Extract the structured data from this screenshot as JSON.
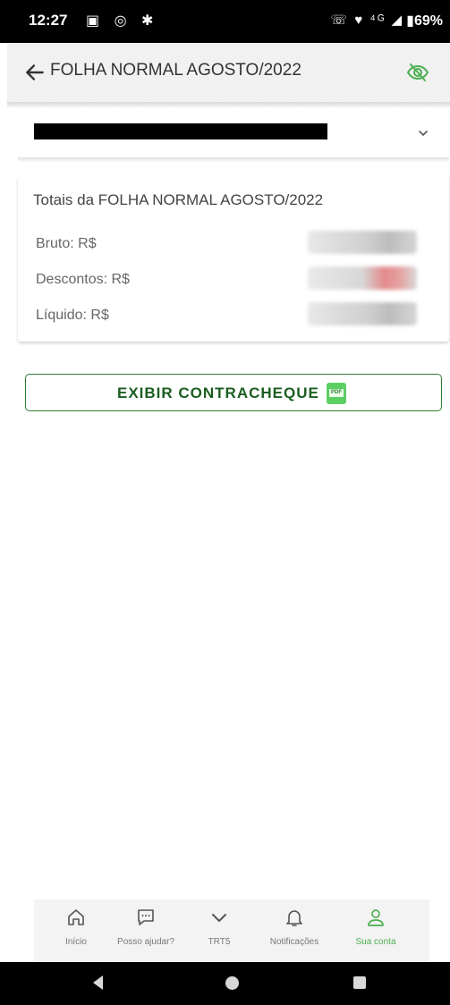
{
  "status_bar": {
    "time": "12:27",
    "left_icons": "▣ ◎ ✱",
    "right_icons": "☏ ♥ ⁴ᴳ ◢",
    "battery": "▮69%"
  },
  "header": {
    "title": "FOLHA NORMAL AGOSTO/2022",
    "back_icon": "arrow-left-icon",
    "visibility_icon": "eye-off-icon",
    "accent_color": "#4caf50"
  },
  "selector": {
    "value_redacted": true,
    "dropdown_icon": "chevron-down-icon"
  },
  "totals": {
    "title": "Totais da FOLHA NORMAL AGOSTO/2022",
    "rows": [
      {
        "label": "Bruto: R$",
        "value_blurred": true
      },
      {
        "label": "Descontos: R$",
        "value_blurred": true,
        "color": "#e57373"
      },
      {
        "label": "Líquido: R$",
        "value_blurred": true
      }
    ]
  },
  "actions": {
    "view_paycheck_label": "EXIBIR CONTRACHEQUE",
    "pdf_icon": "pdf-file-icon",
    "pdf_icon_text": "PDF",
    "border_color": "#2e7d32"
  },
  "bottom_nav": {
    "items": [
      {
        "label": "Início",
        "icon": "home-icon",
        "active": false
      },
      {
        "label": "Posso ajudar?",
        "icon": "chat-icon",
        "active": false
      },
      {
        "label": "TRT5",
        "icon": "chevron-down-icon",
        "active": false
      },
      {
        "label": "Notificações",
        "icon": "bell-icon",
        "active": false
      },
      {
        "label": "Sua conta",
        "icon": "user-icon",
        "active": true
      }
    ]
  }
}
